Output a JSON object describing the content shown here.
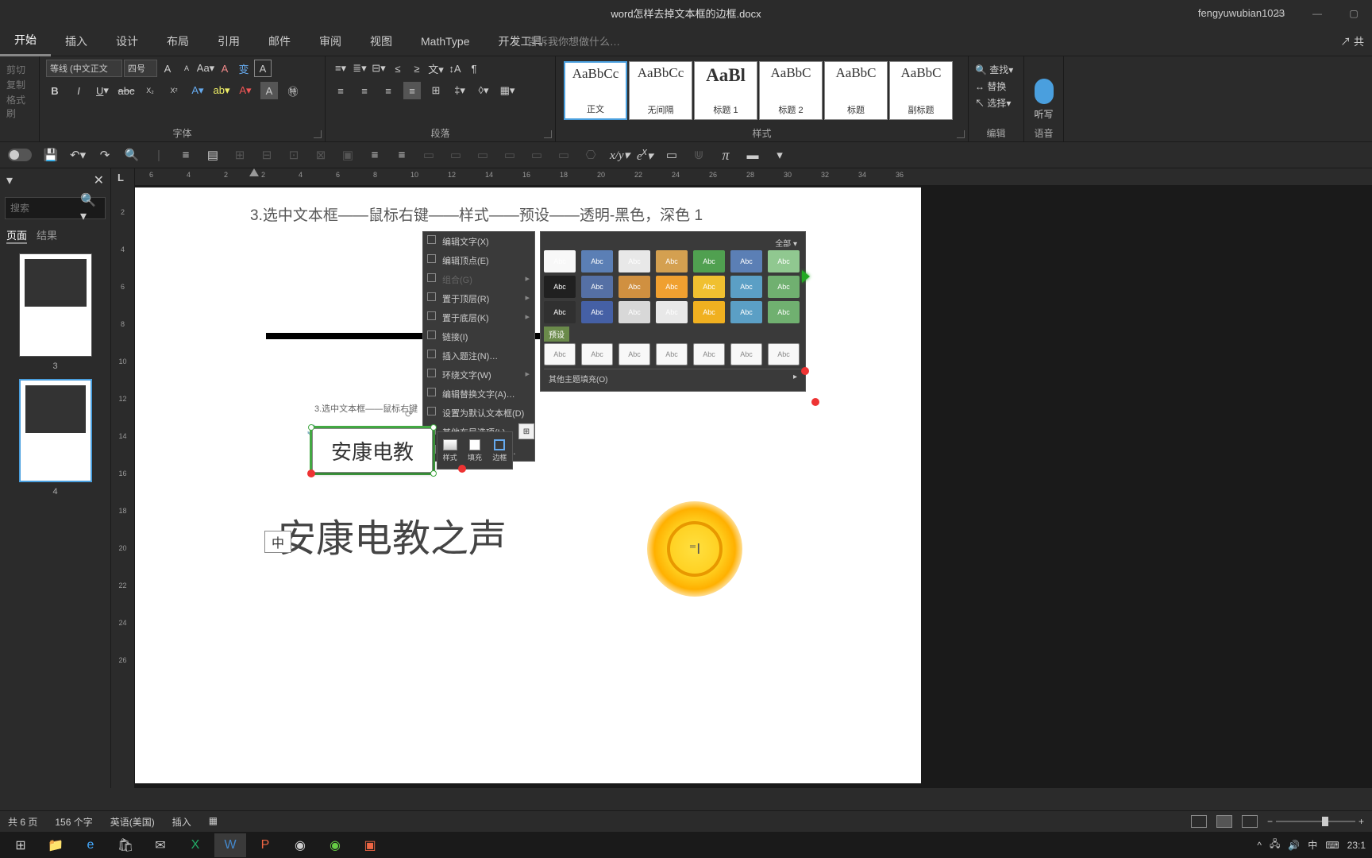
{
  "title": "word怎样去掉文本框的边框.docx",
  "user": "fengyuwubian1023",
  "menuTabs": [
    "开始",
    "插入",
    "设计",
    "布局",
    "引用",
    "邮件",
    "审阅",
    "视图",
    "MathType",
    "开发工具"
  ],
  "tellme": "告诉我你想做什么…",
  "share": "共",
  "clipboard": {
    "cut": "剪切",
    "copy": "复制",
    "painter": "格式刷"
  },
  "font": {
    "name": "等线 (中文正文",
    "size": "四号",
    "group": "字体"
  },
  "para": {
    "group": "段落"
  },
  "styles": {
    "group": "样式",
    "items": [
      {
        "preview": "AaBbCc",
        "name": "正文"
      },
      {
        "preview": "AaBbCc",
        "name": "无间隔"
      },
      {
        "preview": "AaBl",
        "name": "标题 1",
        "big": true
      },
      {
        "preview": "AaBbC",
        "name": "标题 2"
      },
      {
        "preview": "AaBbC",
        "name": "标题"
      },
      {
        "preview": "AaBbC",
        "name": "副标题"
      }
    ]
  },
  "edit": {
    "find": "查找",
    "replace": "替换",
    "select": "选择",
    "group": "编辑"
  },
  "voice": {
    "label": "听写",
    "group": "语音"
  },
  "nav": {
    "search": "搜索",
    "tabs": [
      "页面",
      "结果"
    ],
    "thumbs": [
      "3",
      "4"
    ]
  },
  "rulerH": [
    "6",
    "4",
    "2",
    "2",
    "4",
    "6",
    "8",
    "10",
    "12",
    "14",
    "16",
    "18",
    "20",
    "22",
    "24",
    "26",
    "28",
    "30",
    "32",
    "34",
    "36"
  ],
  "rulerV": [
    "2",
    "4",
    "6",
    "8",
    "10",
    "12",
    "14",
    "16",
    "18",
    "20",
    "22",
    "24",
    "26"
  ],
  "doc": {
    "step": "3.选中文本框——鼠标右键——样式——预设——透明-黑色，深色 1",
    "step_small": "3.选中文本框——鼠标右键",
    "textbox": "安康电教",
    "bigtext": "安康电教之声",
    "ime": "中"
  },
  "ctx": {
    "items": [
      {
        "t": "编辑文字(X)"
      },
      {
        "t": "编辑顶点(E)"
      },
      {
        "t": "组合(G)",
        "dis": true,
        "arr": true
      },
      {
        "t": "置于顶层(R)",
        "arr": true
      },
      {
        "t": "置于底层(K)",
        "arr": true
      },
      {
        "t": "链接(I)"
      },
      {
        "t": "插入题注(N)…"
      },
      {
        "t": "环绕文字(W)",
        "arr": true
      },
      {
        "t": "编辑替换文字(A)…"
      },
      {
        "t": "设置为默认文本框(D)"
      },
      {
        "t": "其他布局选项(L)…"
      },
      {
        "t": "设置形状格式(O)…"
      }
    ]
  },
  "preset": {
    "all": "全部 ▾",
    "label": "预设",
    "other": "其他主题填充(O)",
    "row1": [
      "#f8f8f8",
      "#5b7fb5",
      "#e8e8e8",
      "#d4a050",
      "#50a050",
      "#5b7fb5",
      "#90c890"
    ],
    "row2": [
      "#202020",
      "#5570a5",
      "#d09040",
      "#f0a030",
      "#f0c030",
      "#5b9fc5",
      "#70b070"
    ],
    "row3": [
      "#303030",
      "#4560a5",
      "#d8d8d8",
      "#e8e8e8",
      "#f0b020",
      "#5b9fc5",
      "#70b070"
    ]
  },
  "popup": {
    "style": "样式",
    "fill": "填充",
    "outline": "边框"
  },
  "status": {
    "page": "共 6 页",
    "words": "156 个字",
    "lang": "英语(美国)",
    "mode": "插入"
  },
  "tray": {
    "ime": "中",
    "time": "23:1"
  }
}
